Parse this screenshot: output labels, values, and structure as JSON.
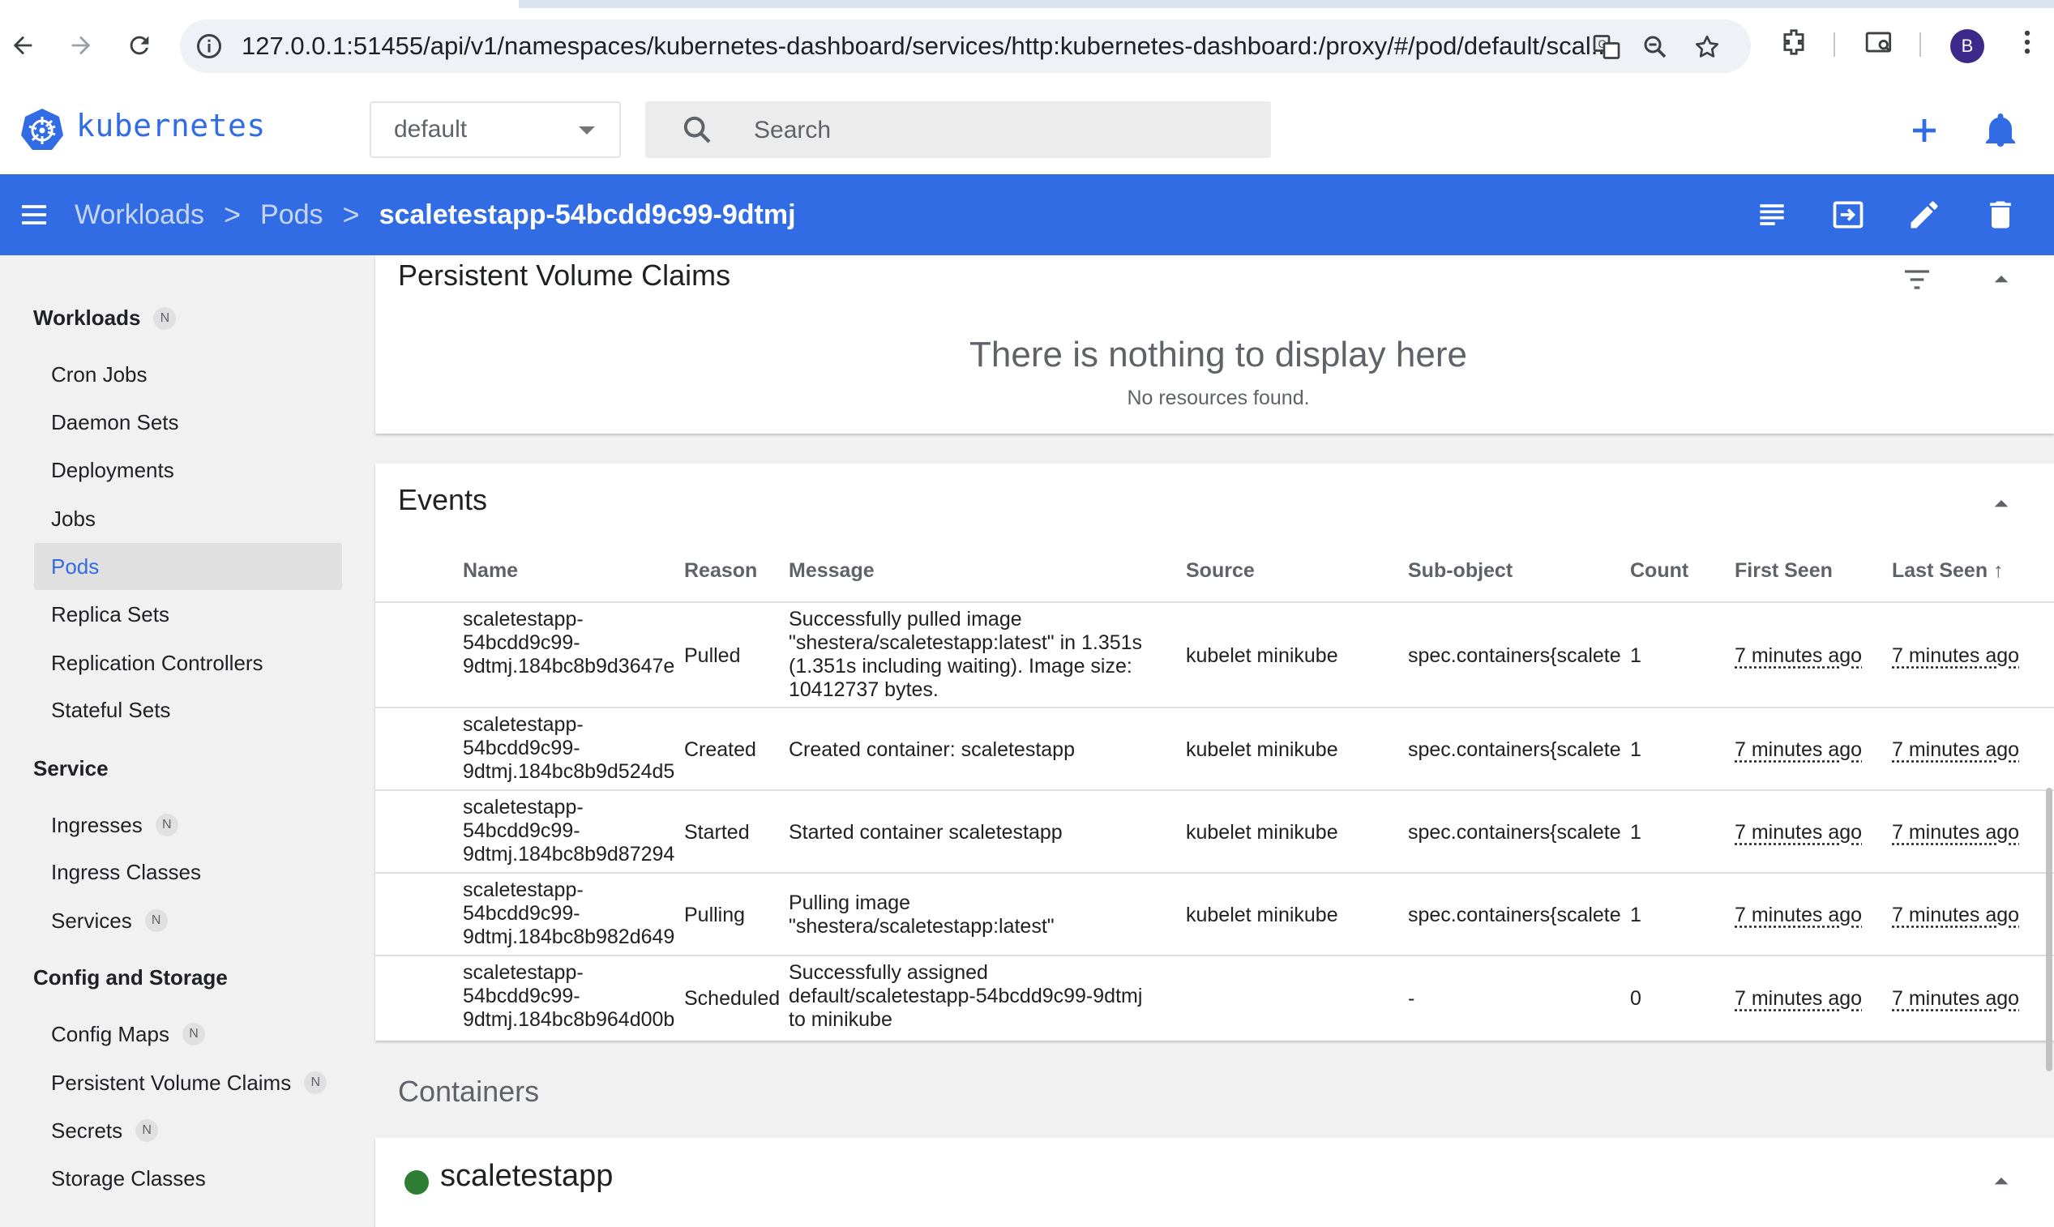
{
  "browser": {
    "url": "127.0.0.1:51455/api/v1/namespaces/kubernetes-dashboard/services/http:kubernetes-dashboard:/proxy/#/pod/default/scal...",
    "profile_initial": "B"
  },
  "header": {
    "brand": "kubernetes",
    "namespace": "default",
    "search_placeholder": "Search"
  },
  "toolbar": {
    "breadcrumb": [
      "Workloads",
      "Pods",
      "scaletestapp-54bcdd9c99-9dtmj"
    ],
    "separator": ">"
  },
  "sidebar": {
    "sections": [
      {
        "label": "Workloads",
        "badge": "N",
        "items": [
          {
            "label": "Cron Jobs"
          },
          {
            "label": "Daemon Sets"
          },
          {
            "label": "Deployments"
          },
          {
            "label": "Jobs"
          },
          {
            "label": "Pods",
            "active": true
          },
          {
            "label": "Replica Sets"
          },
          {
            "label": "Replication Controllers"
          },
          {
            "label": "Stateful Sets"
          }
        ]
      },
      {
        "label": "Service",
        "items": [
          {
            "label": "Ingresses",
            "badge": "N"
          },
          {
            "label": "Ingress Classes"
          },
          {
            "label": "Services",
            "badge": "N"
          }
        ]
      },
      {
        "label": "Config and Storage",
        "items": [
          {
            "label": "Config Maps",
            "badge": "N"
          },
          {
            "label": "Persistent Volume Claims",
            "badge": "N"
          },
          {
            "label": "Secrets",
            "badge": "N"
          },
          {
            "label": "Storage Classes"
          }
        ]
      }
    ]
  },
  "pvc": {
    "title": "Persistent Volume Claims",
    "empty_title": "There is nothing to display here",
    "empty_sub": "No resources found."
  },
  "events": {
    "title": "Events",
    "columns": [
      "Name",
      "Reason",
      "Message",
      "Source",
      "Sub-object",
      "Count",
      "First Seen",
      "Last Seen"
    ],
    "sort_indicator": "↑",
    "rows": [
      {
        "name": [
          "scaletestapp-",
          "54bcdd9c99-",
          "9dtmj.184bc8b9d3647e"
        ],
        "reason": "Pulled",
        "message": [
          "Successfully pulled image",
          "\"shestera/scaletestapp:latest\" in 1.351s",
          "(1.351s including waiting). Image size:",
          "10412737 bytes."
        ],
        "source": "kubelet minikube",
        "subobject": "spec.containers{scalete",
        "count": "1",
        "first": "7 minutes ago",
        "last": "7 minutes ago"
      },
      {
        "name": [
          "scaletestapp-",
          "54bcdd9c99-",
          "9dtmj.184bc8b9d524d5"
        ],
        "reason": "Created",
        "message": [
          "Created container: scaletestapp"
        ],
        "source": "kubelet minikube",
        "subobject": "spec.containers{scalete",
        "count": "1",
        "first": "7 minutes ago",
        "last": "7 minutes ago"
      },
      {
        "name": [
          "scaletestapp-",
          "54bcdd9c99-",
          "9dtmj.184bc8b9d87294"
        ],
        "reason": "Started",
        "message": [
          "Started container scaletestapp"
        ],
        "source": "kubelet minikube",
        "subobject": "spec.containers{scalete",
        "count": "1",
        "first": "7 minutes ago",
        "last": "7 minutes ago"
      },
      {
        "name": [
          "scaletestapp-",
          "54bcdd9c99-",
          "9dtmj.184bc8b982d649"
        ],
        "reason": "Pulling",
        "message": [
          "Pulling image",
          "\"shestera/scaletestapp:latest\""
        ],
        "source": "kubelet minikube",
        "subobject": "spec.containers{scalete",
        "count": "1",
        "first": "7 minutes ago",
        "last": "7 minutes ago"
      },
      {
        "name": [
          "scaletestapp-",
          "54bcdd9c99-",
          "9dtmj.184bc8b964d00b"
        ],
        "reason": "Scheduled",
        "message": [
          "Successfully assigned",
          "default/scaletestapp-54bcdd9c99-9dtmj",
          "to minikube"
        ],
        "source": "",
        "subobject": "-",
        "count": "0",
        "first": "7 minutes ago",
        "last": "7 minutes ago"
      }
    ]
  },
  "containers": {
    "heading": "Containers",
    "name": "scaletestapp",
    "status_color": "#2e7d32"
  },
  "colors": {
    "accent": "#326ce5"
  }
}
